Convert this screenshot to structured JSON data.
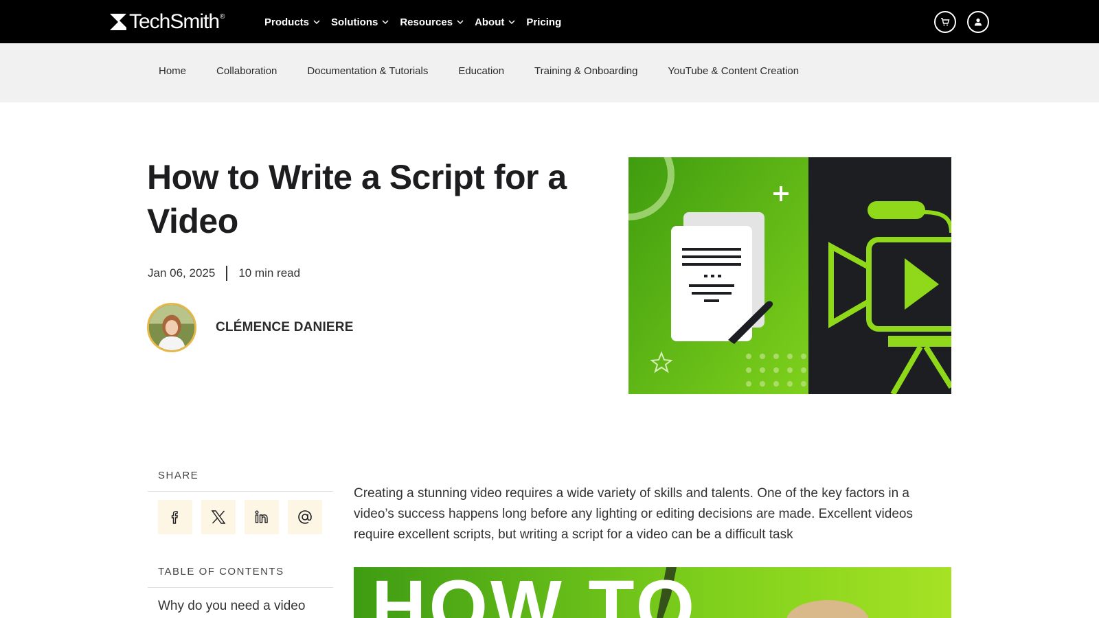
{
  "brand": {
    "name": "TechSmith",
    "reg": "®"
  },
  "main_nav": [
    {
      "label": "Products",
      "has_dropdown": true
    },
    {
      "label": "Solutions",
      "has_dropdown": true
    },
    {
      "label": "Resources",
      "has_dropdown": true
    },
    {
      "label": "About",
      "has_dropdown": true
    },
    {
      "label": "Pricing",
      "has_dropdown": false
    }
  ],
  "nav_icons": [
    "cart-icon",
    "account-icon"
  ],
  "sub_nav": [
    "Home",
    "Collaboration",
    "Documentation & Tutorials",
    "Education",
    "Training & Onboarding",
    "YouTube & Content Creation"
  ],
  "article": {
    "title": "How to Write a Script for a Video",
    "date": "Jan 06, 2025",
    "read_time": "10 min read",
    "author": "CLÉMENCE DANIERE",
    "intro": "Creating a stunning video requires a wide variety of skills and talents. One of the key factors in a video’s success happens long before any lighting or editing decisions are made. Excellent videos require excellent scripts, but writing a script for a video can be a difficult task",
    "thumbnail_text": "HOW TO"
  },
  "sidebar": {
    "share_label": "SHARE",
    "share_icons": [
      "facebook-icon",
      "x-icon",
      "linkedin-icon",
      "email-icon"
    ],
    "toc_label": "TABLE OF CONTENTS",
    "toc_first": "Why do you need a video script?"
  },
  "colors": {
    "accent_green": "#8fd91a",
    "dark_panel": "#1c1e22",
    "share_bg": "#fdf6e4"
  }
}
